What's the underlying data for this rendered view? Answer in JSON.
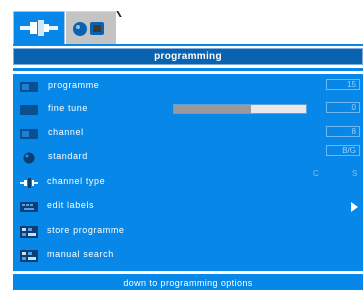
{
  "tabs": [
    {
      "name": "connection",
      "icon": "connector-icon",
      "active": true
    },
    {
      "name": "tv",
      "icon": "tv-icon",
      "active": false
    }
  ],
  "title": "programming",
  "menu": {
    "items": [
      {
        "label": "programme",
        "value": "15",
        "icon": "monitor-icon"
      },
      {
        "label": "fine tune",
        "value": "0",
        "slider_fraction": 0.58,
        "icon": "monitor-icon"
      },
      {
        "label": "channel",
        "value": "8",
        "icon": "monitor-icon"
      },
      {
        "label": "standard",
        "value": "B/G",
        "icon": "globe-icon"
      },
      {
        "label": "channel type",
        "options": [
          "C",
          "S"
        ],
        "icon": "antenna-icon"
      },
      {
        "label": "edit labels",
        "icon": "keyboard-icon"
      },
      {
        "label": "store programme",
        "icon": "grid-icon"
      },
      {
        "label": "manual search",
        "icon": "grid-icon"
      }
    ]
  },
  "footer": {
    "hint": "down to programming options"
  },
  "colors": {
    "accent": "#0788e8",
    "title_bar": "#0a63b0",
    "tab_inactive": "#c4c4c4"
  }
}
